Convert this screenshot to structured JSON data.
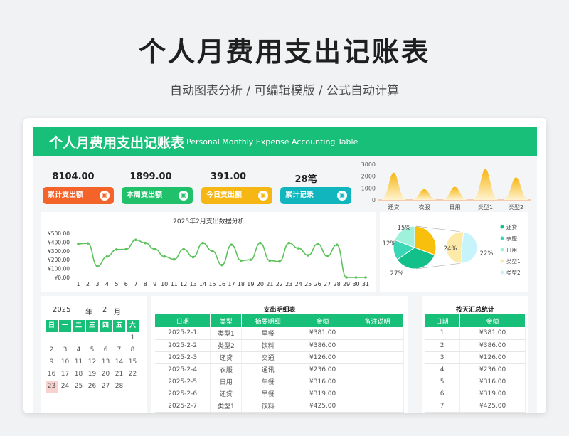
{
  "header": {
    "title": "个人月费用支出记账表",
    "subtitle": "自动图表分析 / 可编辑模版 / 公式自动计算"
  },
  "banner": {
    "title_cn": "个人月费用支出记账表",
    "title_en": "Personal Monthly Expense Accounting Table"
  },
  "kpis": [
    {
      "value": "8104.00",
      "label": "累计支出额",
      "color": "#f4632a"
    },
    {
      "value": "1899.00",
      "label": "本周支出额",
      "color": "#21c06b"
    },
    {
      "value": "391.00",
      "label": "今日支出额",
      "color": "#f6b613"
    },
    {
      "value": "28笔",
      "label": "累计记录",
      "color": "#10b5bd"
    }
  ],
  "kpi_icon": "▣",
  "mini_chart": {
    "y_ticks": [
      "3000",
      "2000",
      "1000",
      "0"
    ],
    "categories": [
      "还贷",
      "衣服",
      "日用",
      "类型1",
      "类型2"
    ],
    "values": [
      2300,
      900,
      1100,
      2600,
      1900
    ],
    "ylim": [
      0,
      3000
    ]
  },
  "line_chart": {
    "title": "2025年2月支出数据分析",
    "y_ticks": [
      "¥500.00",
      "¥400.00",
      "¥300.00",
      "¥200.00",
      "¥100.00",
      "¥0.00"
    ],
    "x_labels": [
      "1",
      "2",
      "3",
      "4",
      "5",
      "6",
      "7",
      "8",
      "9",
      "10",
      "11",
      "12",
      "13",
      "14",
      "15",
      "16",
      "17",
      "18",
      "19",
      "20",
      "21",
      "22",
      "23",
      "24",
      "25",
      "26",
      "27",
      "28",
      "29",
      "30",
      "31"
    ]
  },
  "chart_data": [
    {
      "type": "area",
      "categories": [
        "还贷",
        "衣服",
        "日用",
        "类型1",
        "类型2"
      ],
      "values": [
        2300,
        900,
        1100,
        2600,
        1900
      ],
      "ylim": [
        0,
        3000
      ],
      "y_ticks": [
        0,
        1000,
        2000,
        3000
      ]
    },
    {
      "type": "line",
      "title": "2025年2月支出数据分析",
      "x": [
        1,
        2,
        3,
        4,
        5,
        6,
        7,
        8,
        9,
        10,
        11,
        12,
        13,
        14,
        15,
        16,
        17,
        18,
        19,
        20,
        21,
        22,
        23,
        24,
        25,
        26,
        27,
        28,
        29,
        30,
        31
      ],
      "values": [
        381,
        386,
        126,
        236,
        316,
        319,
        425,
        390,
        320,
        236,
        205,
        319,
        230,
        390,
        300,
        140,
        370,
        190,
        200,
        390,
        190,
        180,
        390,
        330,
        250,
        380,
        240,
        370,
        0,
        0,
        0
      ],
      "ylim": [
        0,
        500
      ],
      "color": "#5cc35c"
    },
    {
      "type": "pie",
      "categories": [
        "还贷",
        "衣服",
        "日用",
        "类型1",
        "类型2"
      ],
      "values": [
        27,
        12,
        15,
        24,
        22
      ],
      "labels": [
        "27%",
        "12%",
        "15%",
        "24%",
        "22%"
      ],
      "colors": [
        "#13c08a",
        "#3ad6b5",
        "#9ff1db",
        "#fde9a8",
        "#c7f4fb"
      ],
      "highlight_color": "#f9bf0d"
    }
  ],
  "pie_legend": [
    {
      "label": "还贷",
      "color": "#13c08a"
    },
    {
      "label": "衣服",
      "color": "#3ad6b5"
    },
    {
      "label": "日用",
      "color": "#9ff1db"
    },
    {
      "label": "类型1",
      "color": "#fde9a8"
    },
    {
      "label": "类型2",
      "color": "#c7f4fb"
    }
  ],
  "pie_labels": [
    "15%",
    "12%",
    "27%",
    "24%",
    "22%"
  ],
  "calendar": {
    "year": "2025",
    "year_unit": "年",
    "month": "2",
    "month_unit": "月",
    "weekdays": [
      "日",
      "一",
      "二",
      "三",
      "四",
      "五",
      "六"
    ],
    "days": [
      "1",
      "2",
      "3",
      "4",
      "5",
      "6",
      "7",
      "8",
      "9",
      "10",
      "11",
      "12",
      "13",
      "14",
      "15",
      "16",
      "17",
      "18",
      "19",
      "20",
      "21",
      "22",
      "23",
      "24",
      "25",
      "26",
      "27",
      "28"
    ],
    "today": "23"
  },
  "detail_table": {
    "title": "支出明细表",
    "headers": [
      "日期",
      "类型",
      "摘要明细",
      "金额",
      "备注说明"
    ],
    "rows": [
      [
        "2025-2-1",
        "类型1",
        "早餐",
        "¥381.00",
        ""
      ],
      [
        "2025-2-2",
        "类型2",
        "饮料",
        "¥386.00",
        ""
      ],
      [
        "2025-2-3",
        "还贷",
        "交通",
        "¥126.00",
        ""
      ],
      [
        "2025-2-4",
        "衣服",
        "通讯",
        "¥236.00",
        ""
      ],
      [
        "2025-2-5",
        "日用",
        "午餐",
        "¥316.00",
        ""
      ],
      [
        "2025-2-6",
        "还贷",
        "早餐",
        "¥319.00",
        ""
      ],
      [
        "2025-2-7",
        "类型1",
        "饮料",
        "¥425.00",
        ""
      ]
    ]
  },
  "daily_table": {
    "title": "按天汇总统计",
    "headers": [
      "日期",
      "金额"
    ],
    "rows": [
      [
        "1",
        "¥381.00"
      ],
      [
        "2",
        "¥386.00"
      ],
      [
        "3",
        "¥126.00"
      ],
      [
        "4",
        "¥236.00"
      ],
      [
        "5",
        "¥316.00"
      ],
      [
        "6",
        "¥319.00"
      ],
      [
        "7",
        "¥425.00"
      ]
    ]
  }
}
